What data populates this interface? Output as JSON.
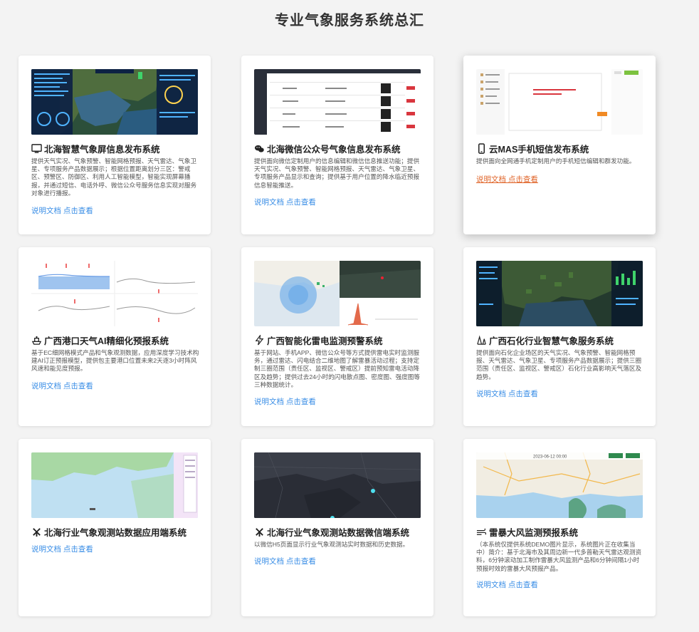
{
  "page": {
    "title": "专业气象服务系统总汇"
  },
  "cards": [
    {
      "title": "北海智慧气象屏信息发布系统",
      "desc": "提供天气实况、气象预警、智能网格预报、天气雷达、气象卫星、专项服务产品数据展示；根据位置距离划分三区：警戒区、预警区、防御区、利用人工智能模型，智能实现屏幕播报，并通过短信、电话外呼、微信公众号服务信息实现对服务对象进行播报。",
      "link": "说明文档 点击查看",
      "icon": "monitor-icon"
    },
    {
      "title": "北海微信公众号气象信息发布系统",
      "desc": "提供面向微信定制用户的信息编辑和微信信息推送功能；提供天气实况、气象预警、智能网格预报、天气雷达、气象卫星、专项服务产品显示和查询；提供基于用户位置的降水临近预报信息智能推送。",
      "link": "说明文档 点击查看",
      "icon": "wechat-icon"
    },
    {
      "title": "云MAS手机短信发布系统",
      "desc": "提供面向全网通手机定制用户的手机短信编辑和群发功能。",
      "link": "说明文档 点击查看",
      "icon": "phone-icon"
    },
    {
      "title": "广西港口天气AI精细化预报系统",
      "desc": "基于EC细网格模式产品和气象观测数据，应用深度学习技术构建AI订正预报模型，提供包主要港口位置未来2天逐3小时阵风风速和能见度预报。",
      "link": "说明文档 点击查看",
      "icon": "ship-icon"
    },
    {
      "title": "广西智能化雷电监测预警系统",
      "desc": "基于网站、手机APP、微信公众号等方式提供雷电实时监测服务，通过雷达、闪电结合二维地图了解雷暴活动过程；支持定制三圈范围（责任区、监视区、警戒区）提前预知雷电活动降区及趋势；提供过去24小时的闪电散点图、密度图、强度图等三种数据统计。",
      "link": "说明文档 点击查看",
      "icon": "lightning-icon"
    },
    {
      "title": "广西石化行业智慧气象服务系统",
      "desc": "提供面向石化企业场区的天气实况、气象预警、智能网格预报、天气雷达、气象卫星、专项服务产品数据展示；提供三圈范围（责任区、监视区、警戒区）石化行业高影响天气落区及趋势。",
      "link": "说明文档 点击查看",
      "icon": "factory-icon"
    },
    {
      "title": "北海行业气象观测站数据应用端系统",
      "desc": "",
      "link": "说明文档 点击查看",
      "icon": "windmill-icon"
    },
    {
      "title": "北海行业气象观测站数据微信端系统",
      "desc": "以微信H5页面显示行业气象观测站实时数据和历史数据。",
      "link": "说明文档 点击查看",
      "icon": "windmill-icon"
    },
    {
      "title": "雷暴大风监测预报系统",
      "desc": "（本系统仅提供系统DEMO图片显示，系统图片正在收集当中）简介：基于北海市及其周边新一代多普勒天气雷达观测资料，6分钟滚动加工制作雷暴大风监测产品和6分钟间隔1小时预报时效的雷暴大风预报产品。",
      "link": "说明文档 点击查看",
      "icon": "wind-icon"
    }
  ],
  "thumb_text": {
    "sms_top_buttons": [
      "群发",
      "发送记录"
    ],
    "sms_list_item": "用户短信列表",
    "storm_date": "2023-06-12 00:00"
  },
  "colors": {
    "link": "#3a8ee6",
    "link_active": "#e0662b",
    "page_bg": "#f3f3f3"
  }
}
